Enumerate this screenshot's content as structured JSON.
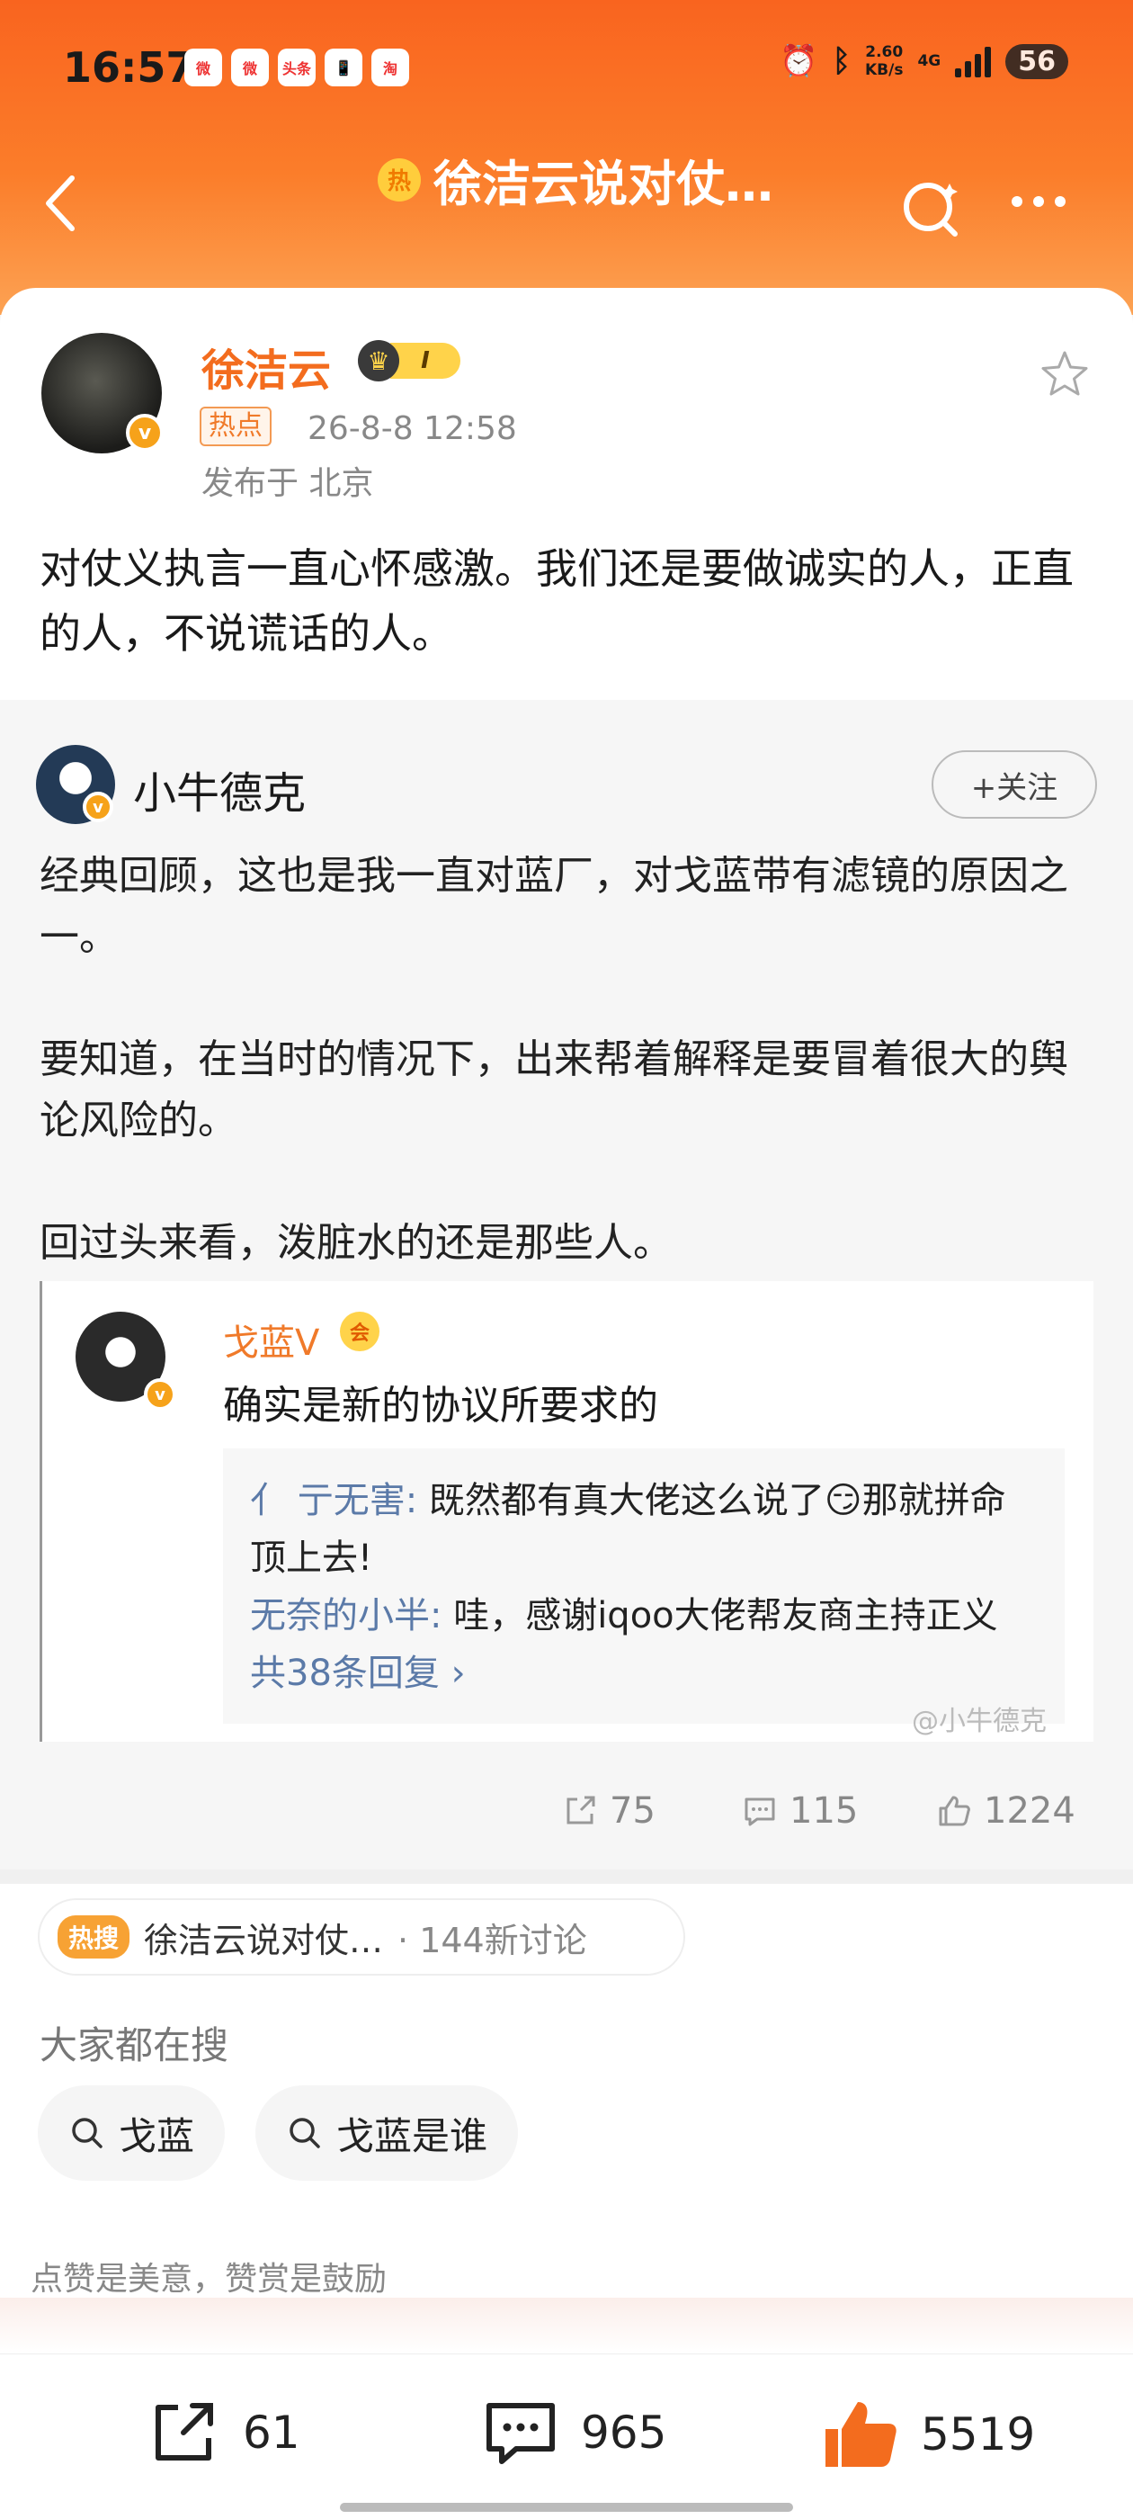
{
  "status_bar": {
    "time": "16:57",
    "apps": [
      "微",
      "微",
      "头条",
      "📱",
      "淘"
    ],
    "speed": "2.60",
    "speed_unit": "KB/s",
    "network": "4G",
    "battery": "56"
  },
  "nav": {
    "hot_badge": "热",
    "title": "徐洁云说对仗…"
  },
  "post": {
    "author": "徐洁云",
    "level": "I",
    "hot_tag": "热点",
    "time": "26-8-8 12:58",
    "location": "发布于 北京",
    "text": "对仗义执言一直心怀感激。我们还是要做诚实的人，正直的人，不说谎话的人。"
  },
  "repost": {
    "author": "小牛德克",
    "follow_label": "+关注",
    "paragraphs": [
      "经典回顾，这也是我一直对蓝厂，对戈蓝带有滤镜的原因之一。",
      "要知道，在当时的情况下，出来帮着解释是要冒着很大的舆论风险的。",
      "回过头来看，泼脏水的还是那些人。"
    ],
    "quoted": {
      "author": "戈蓝V",
      "text": "确实是新的协议所要求的",
      "replies": [
        {
          "user": "亻 亍无害:",
          "text": " 既然都有真大佬这么说了😏那就拼命顶上去!"
        },
        {
          "user": "无奈的小半:",
          "text": " 哇，感谢iqoo大佬帮友商主持正义"
        }
      ],
      "more": "共38条回复 ›"
    },
    "watermark": "@小牛德克",
    "stats": {
      "share": "75",
      "comment": "115",
      "like": "1224"
    }
  },
  "topic": {
    "badge": "热搜",
    "title": "徐洁云说对仗…",
    "count": "· 144新讨论"
  },
  "search": {
    "heading": "大家都在搜",
    "chips": [
      "戈蓝",
      "戈蓝是谁"
    ]
  },
  "praise_text": "点赞是美意，赞赏是鼓励",
  "bottom": {
    "share": "61",
    "comment": "965",
    "like": "5519"
  },
  "colors": {
    "header": "#f9641f",
    "accent": "#f36c1e",
    "link": "#5b7aa8"
  }
}
